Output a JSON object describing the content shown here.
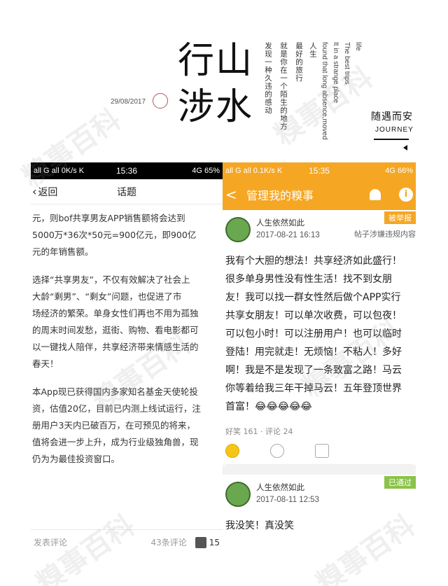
{
  "header": {
    "title_col1": "行\n涉",
    "title_col2": "山\n水",
    "date": "29/08/2017",
    "vertical_lines_cn": [
      "人生",
      "最好的旅行",
      "就是你在一个陌生的地方",
      "发现一种久违的感动"
    ],
    "vertical_lines_en": [
      "life",
      "The best trips",
      "It in a strange place",
      "found that long absence,moved"
    ],
    "slogan": "随遇而安",
    "journey": "JOURNEY",
    "heart_icon": "heart-icon"
  },
  "left_phone": {
    "status": {
      "left": "all G all 0K/s K",
      "time": "15:36",
      "right": "4G 65%"
    },
    "nav": {
      "back_label": "返回",
      "title": "话题"
    },
    "paragraphs": [
      "元，则bof共享男友APP销售额将会达到\n5000万*36次*50元=900亿元，即900亿\n元的年销售额。",
      "选择“共享男友”，不仅有效解决了社会上\n大龄“剩男”、“剩女”问题，也促进了市\n场经济的繁荣。单身女性们再也不用为孤独\n的周末时间发愁，逛街、购物、看电影都可\n以一键找人陪伴，共享经济带来情感生活的\n春天！",
      "本App现已获得国内多家知名基金天使轮投\n资，估值20亿，目前已内测上线试运行，注\n册用户3天内已破百万，在可预见的将来，\n值将会进一步上升，成为行业级独角兽，现\n仍为为最佳投资窗口。"
    ],
    "comment_bar": {
      "placeholder": "发表评论",
      "count": "43条评论",
      "likes": "15"
    }
  },
  "right_phone": {
    "status": {
      "left": "all G all 0.1K/s K",
      "time": "15:35",
      "right": "4G 66%"
    },
    "nav": {
      "back": "<",
      "title": "管理我的糗事"
    },
    "posts": [
      {
        "name": "人生依然如此",
        "time": "2017-08-21 16:13",
        "badge": "被举报",
        "tag": "帖子涉嫌违规内容",
        "body": "我有个大胆的想法！共享经济如此盛行！\n很多单身男性没有性生活！找不到女朋\n友！我可以找一群女性然后做个APP实行\n共享女朋友！可以单次收费，可以包夜！\n可以包小时！可以注册用户！也可以临时\n登陆！用完就走！无烦恼！不粘人！多好\n啊！我是不是发现了一条致富之路！马云\n你等着给我三年干掉马云！五年登顶世界\n首富！😂😂😂😂😂",
        "stats": "好笑 161 · 评论 24"
      },
      {
        "name": "人生依然如此",
        "time": "2017-08-11 12:53",
        "badge": "已通过",
        "body": "我没笑！真没笑"
      }
    ]
  },
  "watermark": "糗事百科"
}
